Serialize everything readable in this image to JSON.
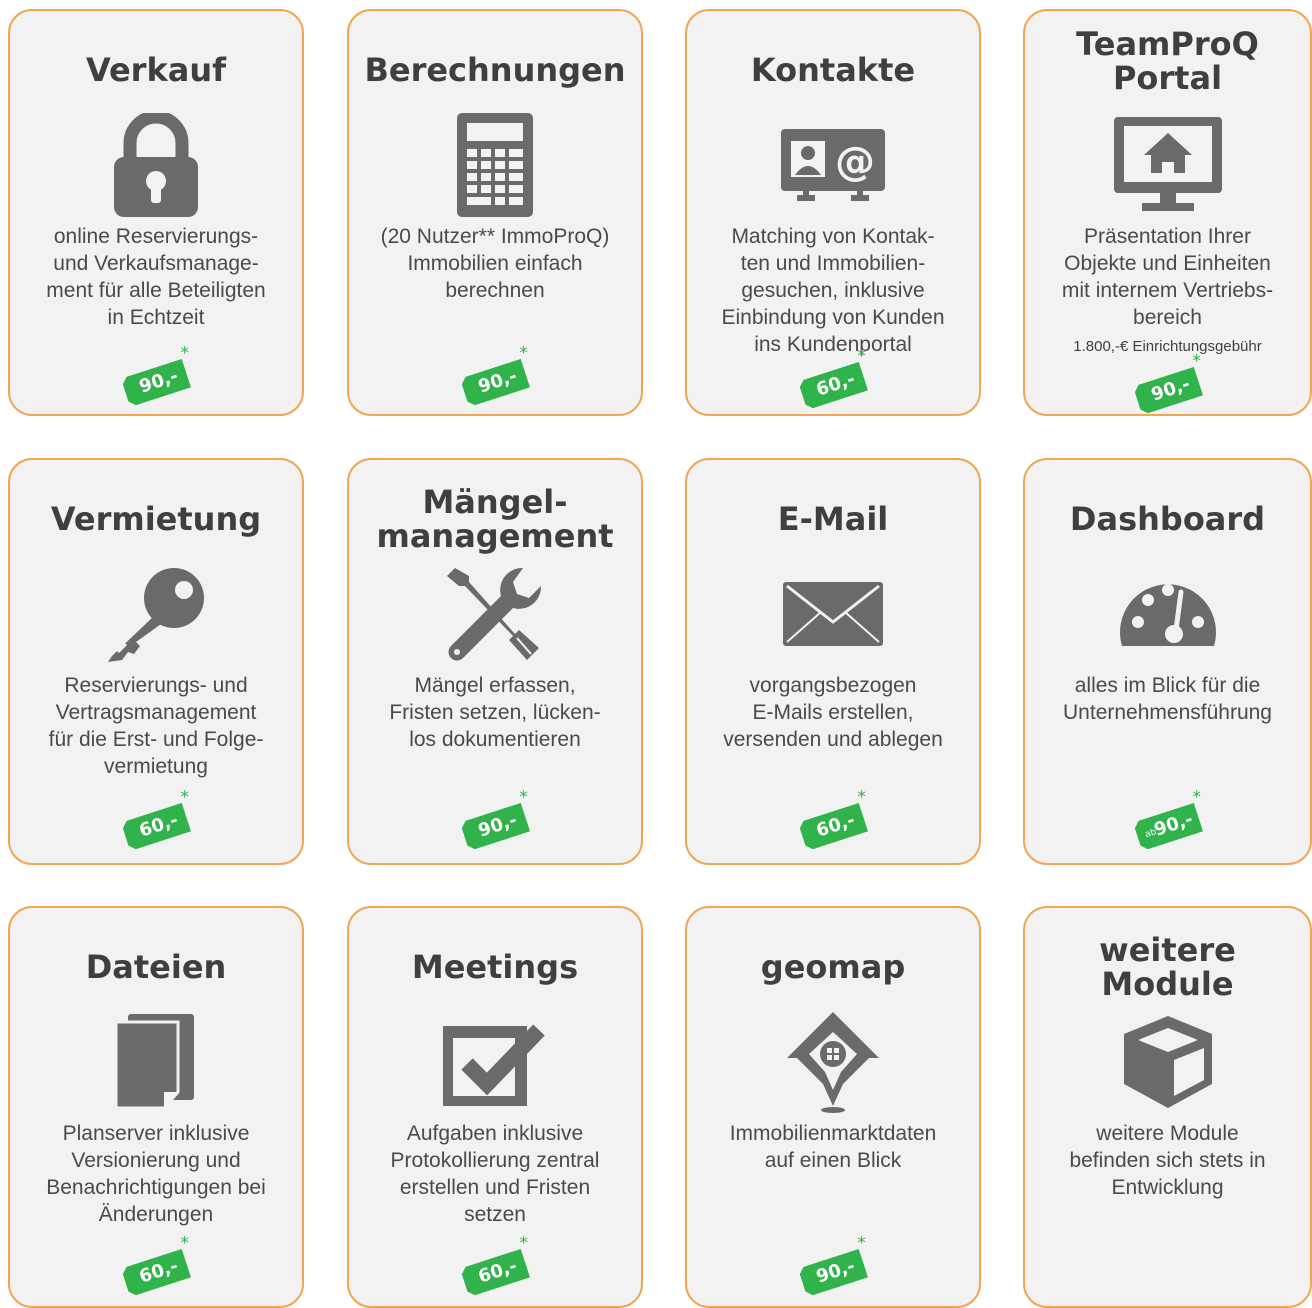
{
  "colors": {
    "border": "#f2a654",
    "card_bg": "#f2f2f2",
    "icon": "#6a6a6a",
    "price_tag": "#2fb34a"
  },
  "modules": [
    {
      "title": "Verkauf",
      "icon": "lock-icon",
      "description": "online Reservierungs-\nund Verkaufsmanage-\nment für alle Beteiligten\nin Echtzeit",
      "price": "90,-",
      "star": "*"
    },
    {
      "title": "Berechnungen",
      "icon": "calculator-icon",
      "description": "(20 Nutzer** ImmoProQ)\nImmobilien einfach\nberechnen",
      "price": "90,-",
      "star": "*"
    },
    {
      "title": "Kontakte",
      "icon": "contact-card-icon",
      "description": "Matching von Kontak-\nten und Immobilien-\ngesuchen, inklusive\nEinbindung von Kunden\nins Kundenportal",
      "price": "60,-",
      "star": "*"
    },
    {
      "title": "TeamProQ\nPortal",
      "icon": "monitor-home-icon",
      "description": "Präsentation Ihrer\nObjekte und Einheiten\nmit internem Vertriebs-\nbereich",
      "note": "1.800,-€ Einrichtungsgebühr",
      "price": "90,-",
      "star": "*"
    },
    {
      "title": "Vermietung",
      "icon": "key-icon",
      "description": "Reservierungs- und\nVertragsmanagement\nfür die Erst- und Folge-\nvermietung",
      "price": "60,-",
      "star": "*"
    },
    {
      "title": "Mängel-\nmanagement",
      "icon": "tools-icon",
      "description": "Mängel erfassen,\nFristen setzen, lücken-\nlos dokumentieren",
      "price": "90,-",
      "star": "*"
    },
    {
      "title": "E-Mail",
      "icon": "envelope-icon",
      "description": "vorgangsbezogen\nE-Mails erstellen,\nversenden und ablegen",
      "price": "60,-",
      "star": "*"
    },
    {
      "title": "Dashboard",
      "icon": "gauge-icon",
      "description": "alles im Blick für die\nUnternehmensführung",
      "price": "90,-",
      "price_prefix": "ab",
      "star": "*"
    },
    {
      "title": "Dateien",
      "icon": "files-icon",
      "description": "Planserver inklusive\nVersionierung und\nBenachrichtigungen bei\nÄnderungen",
      "price": "60,-",
      "star": "*"
    },
    {
      "title": "Meetings",
      "icon": "checkbox-icon",
      "description": "Aufgaben inklusive\nProtokollierung zentral\nerstellen und Fristen\nsetzen",
      "price": "60,-",
      "star": "*"
    },
    {
      "title": "geomap",
      "icon": "map-pin-house-icon",
      "description": "Immobilienmarktdaten\nauf einen Blick",
      "price": "90,-",
      "star": "*"
    },
    {
      "title": "weitere\nModule",
      "icon": "box-icon",
      "description": "weitere Module\nbefinden sich stets in\nEntwicklung"
    }
  ]
}
